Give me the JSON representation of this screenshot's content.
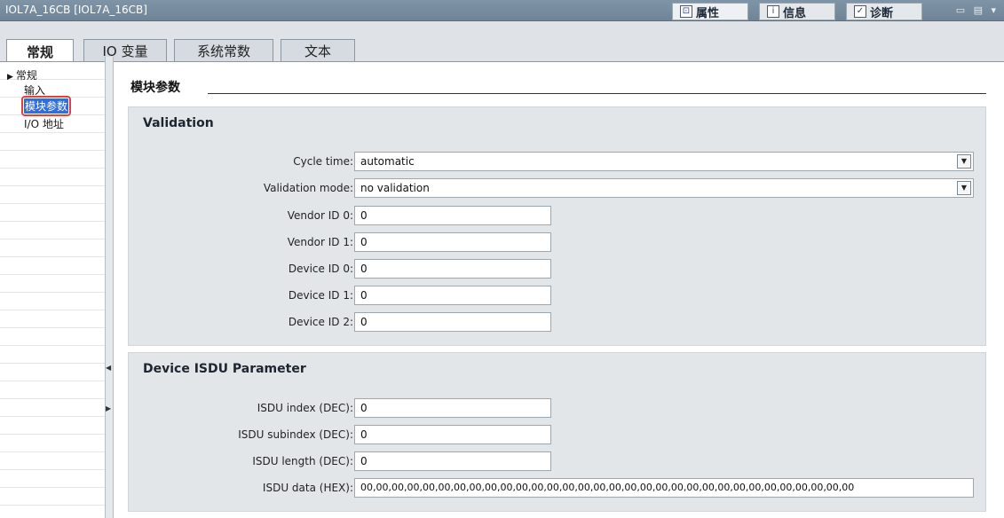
{
  "window": {
    "title": "IOL7A_16CB [IOL7A_16CB]"
  },
  "panel_tabs": [
    {
      "label": "属性",
      "icon": "properties-icon"
    },
    {
      "label": "信息",
      "icon": "info-icon"
    },
    {
      "label": "诊断",
      "icon": "diagnostics-icon"
    }
  ],
  "tabs": [
    {
      "label": "常规"
    },
    {
      "label": "IO 变量"
    },
    {
      "label": "系统常数"
    },
    {
      "label": "文本"
    }
  ],
  "nav": {
    "parent": "常规",
    "items": [
      "输入",
      "模块参数",
      "I/O 地址"
    ],
    "selected": "模块参数"
  },
  "section": {
    "title": "模块参数"
  },
  "validation": {
    "title": "Validation",
    "cycle_time": {
      "label": "Cycle time:",
      "value": "automatic"
    },
    "validation_mode": {
      "label": "Validation mode:",
      "value": "no validation"
    },
    "vendor_id_0": {
      "label": "Vendor ID 0:",
      "value": "0"
    },
    "vendor_id_1": {
      "label": "Vendor ID 1:",
      "value": "0"
    },
    "device_id_0": {
      "label": "Device ID 0:",
      "value": "0"
    },
    "device_id_1": {
      "label": "Device ID 1:",
      "value": "0"
    },
    "device_id_2": {
      "label": "Device ID 2:",
      "value": "0"
    }
  },
  "isdu": {
    "title": "Device ISDU Parameter",
    "index": {
      "label": "ISDU index (DEC):",
      "value": "0"
    },
    "subindex": {
      "label": "ISDU subindex (DEC):",
      "value": "0"
    },
    "length": {
      "label": "ISDU length (DEC):",
      "value": "0"
    },
    "data": {
      "label": "ISDU data (HEX):",
      "value": "00,00,00,00,00,00,00,00,00,00,00,00,00,00,00,00,00,00,00,00,00,00,00,00,00,00,00,00,00,00,00,00"
    }
  }
}
